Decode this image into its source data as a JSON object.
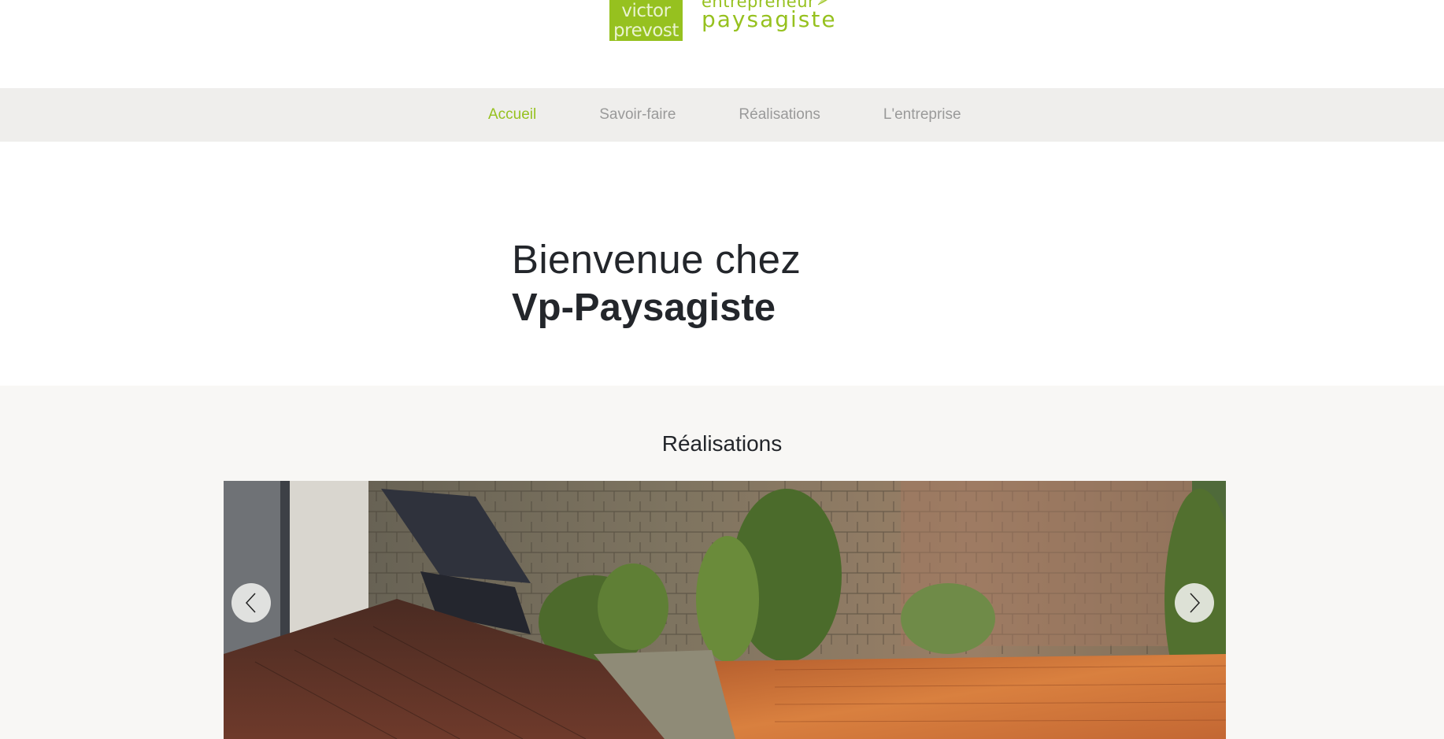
{
  "logo": {
    "box_line1": "victor",
    "box_line2": "prevost",
    "text_line1": "entrepreneur",
    "text_line2": "paysagiste",
    "brand_color": "#96c11f"
  },
  "nav": {
    "items": [
      {
        "label": "Accueil",
        "active": true
      },
      {
        "label": "Savoir-faire",
        "active": false
      },
      {
        "label": "Réalisations",
        "active": false
      },
      {
        "label": "L'entreprise",
        "active": false
      }
    ]
  },
  "hero": {
    "line1": "Bienvenue chez",
    "line2": "Vp-Paysagiste"
  },
  "gallery": {
    "title": "Réalisations",
    "prev_icon": "chevron-left-icon",
    "next_icon": "chevron-right-icon"
  },
  "colors": {
    "accent": "#96c11f",
    "nav_bg": "#efeeec",
    "section_bg": "#f8f7f5",
    "text": "#23262b",
    "nav_text": "#9a9a9a"
  }
}
